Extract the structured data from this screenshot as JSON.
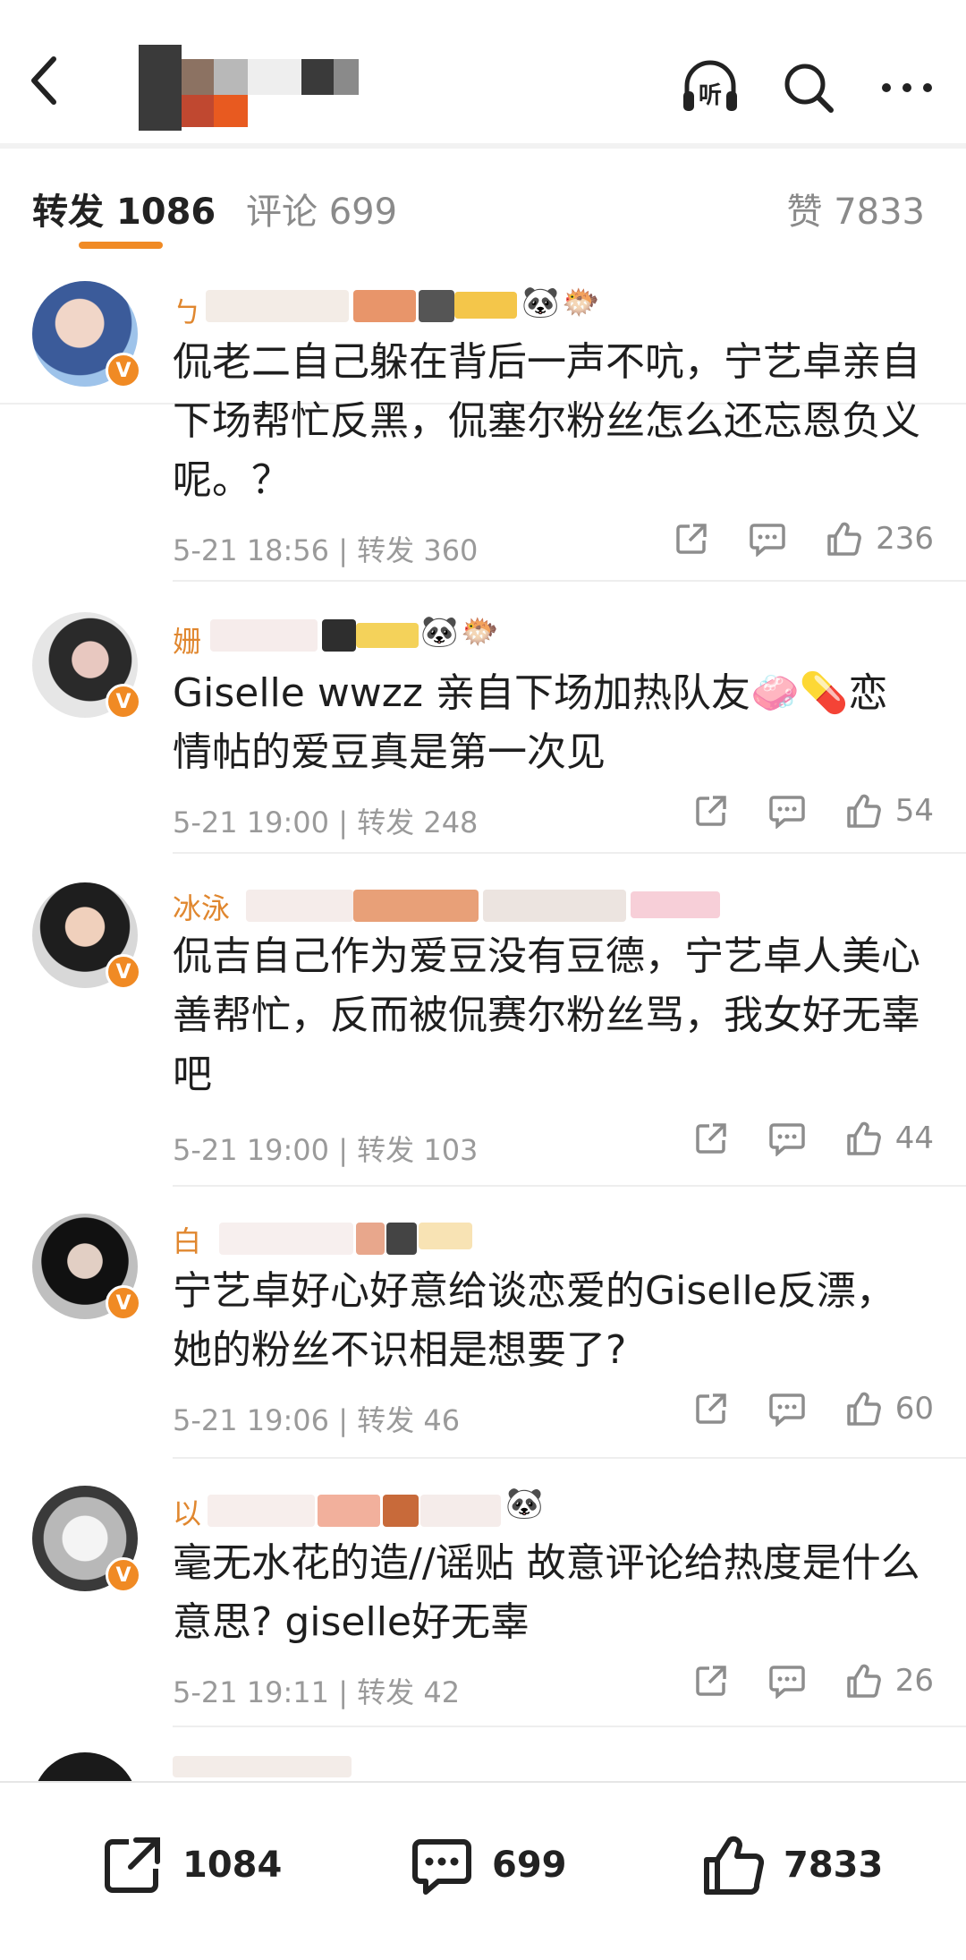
{
  "tabs": {
    "reposts_label": "转发",
    "reposts_count": "1086",
    "comments_label": "评论",
    "comments_count": "699",
    "likes_label": "赞",
    "likes_count": "7833"
  },
  "header_icons": [
    "back-icon",
    "headphones-listen-icon",
    "search-icon",
    "more-icon"
  ],
  "header": {
    "listen_label": "听"
  },
  "comments": [
    {
      "name_prefix": "ㄅ",
      "text": "侃老二自己躲在背后一声不吭，宁艺卓亲自下场帮忙反黑，侃塞尔粉丝怎么还忘恩负义呢。？",
      "time": "5-21 18:56",
      "repost_label": "转发",
      "reposts": "360",
      "likes": "236"
    },
    {
      "name_prefix": "姗",
      "text": "Giselle wwzz 亲自下场加热队友🧼💊恋情帖的爱豆真是第一次见",
      "time": "5-21 19:00",
      "repost_label": "转发",
      "reposts": "248",
      "likes": "54"
    },
    {
      "name_prefix": "冰泳",
      "text": "侃吉自己作为爱豆没有豆德，宁艺卓人美心善帮忙，反而被侃赛尔粉丝骂，我女好无辜吧",
      "time": "5-21 19:00",
      "repost_label": "转发",
      "reposts": "103",
      "likes": "44"
    },
    {
      "name_prefix": "白",
      "text": "宁艺卓好心好意给谈恋爱的Giselle反漂，她的粉丝不识相是想要了?",
      "time": "5-21 19:06",
      "repost_label": "转发",
      "reposts": "46",
      "likes": "60"
    },
    {
      "name_prefix": "以",
      "text": "毫无水花的造//谣贴 故意评论给热度是什么意思? giselle好无辜",
      "time": "5-21 19:11",
      "repost_label": "转发",
      "reposts": "42",
      "likes": "26"
    }
  ],
  "bottom_bar": {
    "reposts": "1084",
    "comments": "699",
    "likes": "7833"
  },
  "colors": {
    "accent": "#f08a24",
    "username": "#e0872f",
    "meta": "#9a9a9a"
  }
}
